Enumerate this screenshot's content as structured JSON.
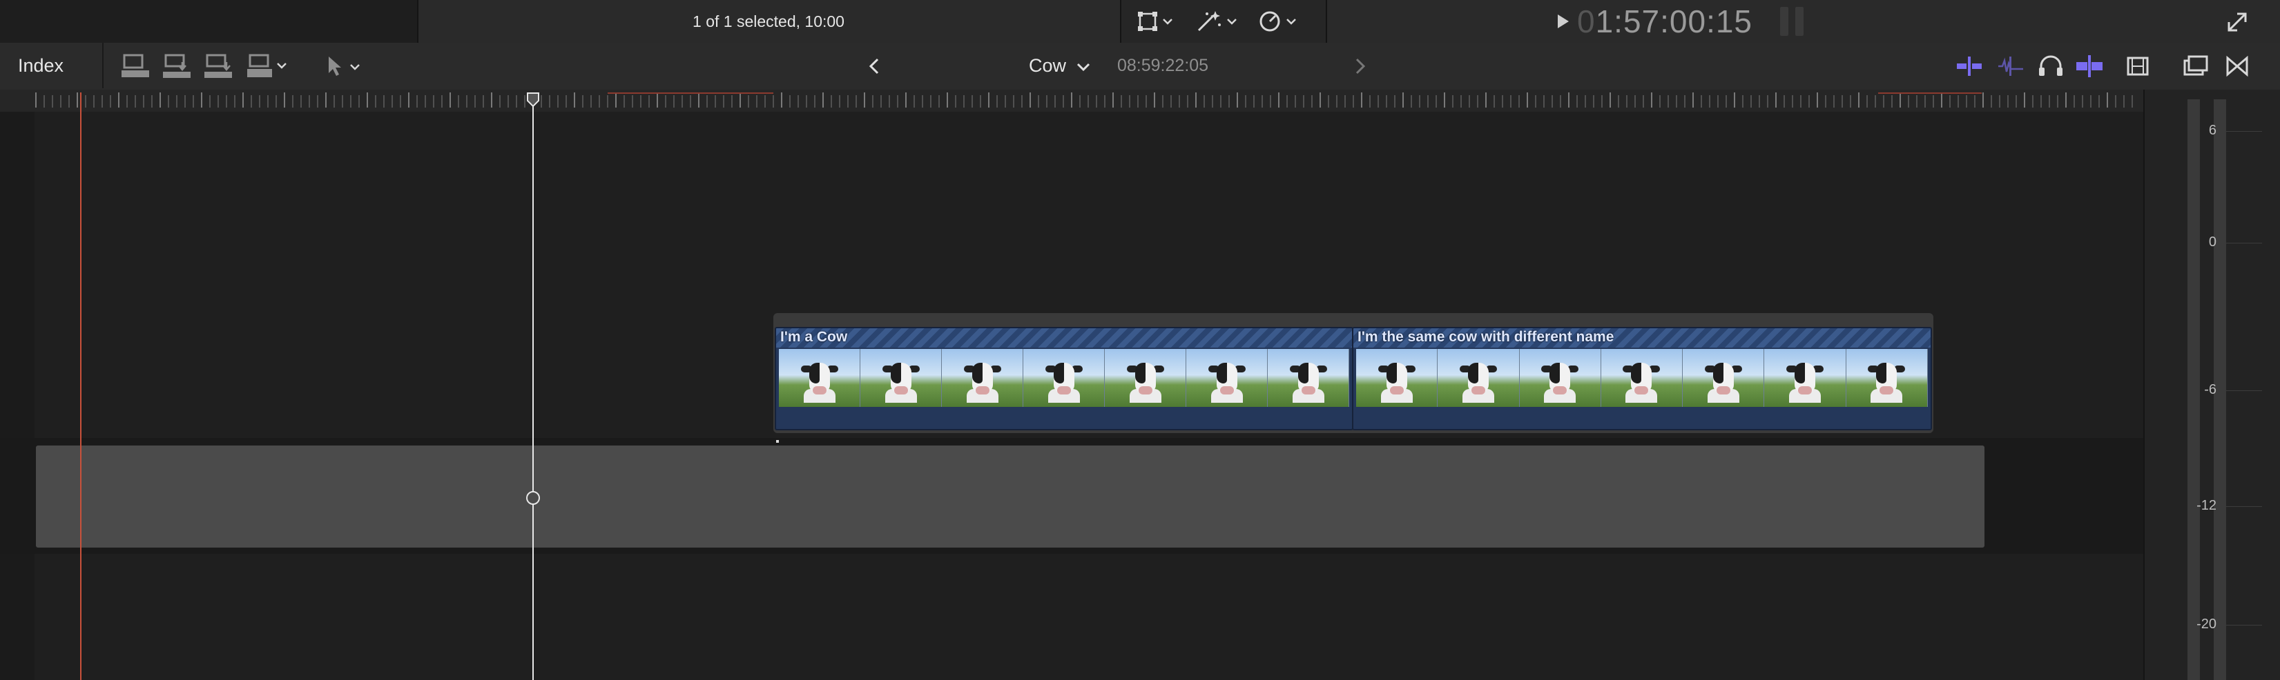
{
  "status": {
    "selection_info": "1 of 1 selected, 10:00"
  },
  "timecode": {
    "lead": "0",
    "value": "1:57:00:15"
  },
  "toolbar": {
    "index_label": "Index",
    "project_name": "Cow",
    "project_duration": "08:59:22:05"
  },
  "clips": [
    {
      "title": "I'm a Cow"
    },
    {
      "title": "I'm the same cow with different name"
    }
  ],
  "meters": {
    "labels": [
      "6",
      "0",
      "-6",
      "-12",
      "-20"
    ]
  },
  "colors": {
    "accent": "#7a6cf0",
    "clip_blue": "#24375a",
    "skimmer": "#c8513b"
  }
}
